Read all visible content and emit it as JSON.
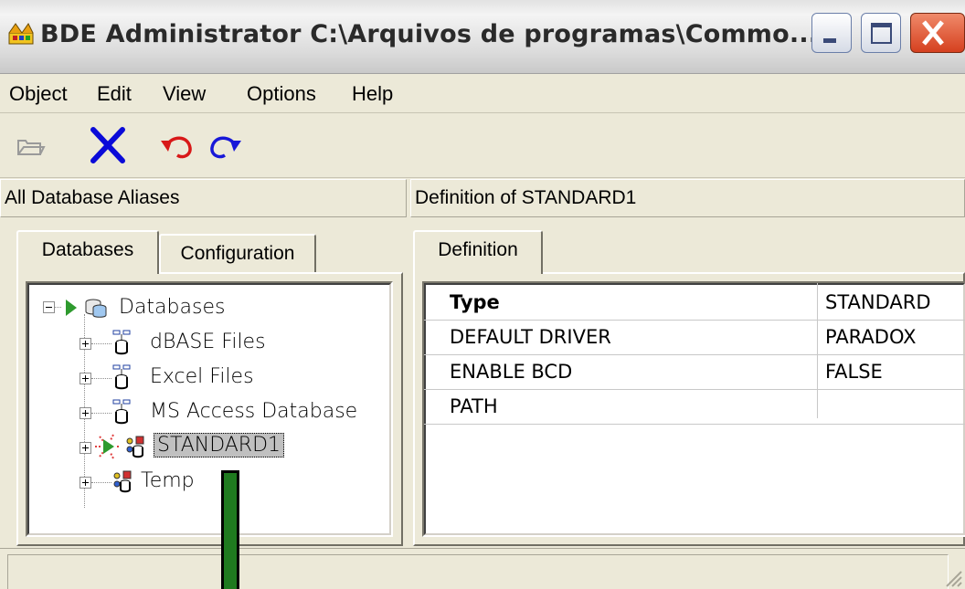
{
  "window": {
    "title": "BDE Administrator  C:\\Arquivos de programas\\Commo...",
    "buttons": {
      "minimize": "minimize",
      "maximize": "maximize",
      "close": "close"
    }
  },
  "menu": {
    "items": [
      {
        "label": "Object"
      },
      {
        "label": "Edit"
      },
      {
        "label": "View"
      },
      {
        "label": "Options"
      },
      {
        "label": "Help"
      }
    ]
  },
  "toolbar": {
    "icons": [
      "open-folder-icon",
      "delete-x-icon",
      "undo-icon",
      "redo-icon"
    ],
    "colors": {
      "delete": "#0a0ad8",
      "undo": "#d81818",
      "redo": "#1818d8"
    }
  },
  "left_panel": {
    "header": "All Database Aliases",
    "tabs": [
      "Databases",
      "Configuration"
    ],
    "active_tab": "Databases",
    "tree": {
      "root": "Databases",
      "children": [
        {
          "label": "dBASE Files"
        },
        {
          "label": "Excel Files"
        },
        {
          "label": "MS Access Database"
        },
        {
          "label": "STANDARD1",
          "selected": true
        },
        {
          "label": "Temp"
        }
      ]
    }
  },
  "right_panel": {
    "header": "Definition of STANDARD1",
    "tabs": [
      "Definition"
    ],
    "rows": [
      {
        "name": "Type",
        "value": "STANDARD"
      },
      {
        "name": "DEFAULT DRIVER",
        "value": "PARADOX"
      },
      {
        "name": "ENABLE BCD",
        "value": "FALSE"
      },
      {
        "name": "PATH",
        "value": ""
      }
    ]
  },
  "annotation": {
    "color": "#1f7a1f"
  }
}
